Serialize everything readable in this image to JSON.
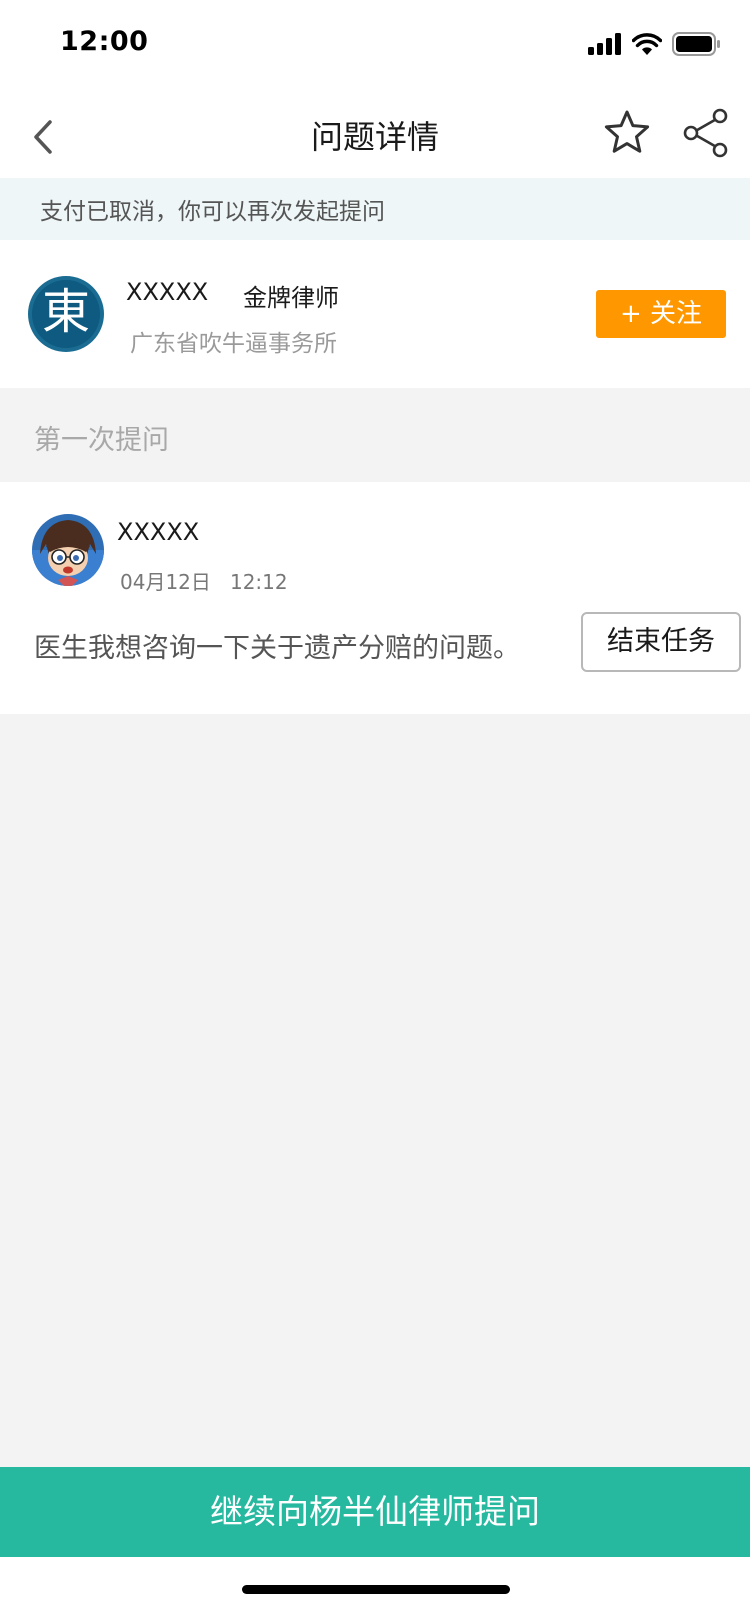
{
  "status_bar": {
    "time": "12:00",
    "icons": [
      "cellular-signal-icon",
      "wifi-icon",
      "battery-icon"
    ]
  },
  "nav": {
    "title": "问题详情",
    "back_icon": "chevron-left-icon",
    "star_icon": "star-outline-icon",
    "share_icon": "share-icon"
  },
  "notice": {
    "text": "支付已取消，你可以再次发起提问"
  },
  "lawyer": {
    "avatar_char": "東",
    "name": "XXXXX",
    "title": "金牌律师",
    "firm": "广东省吹牛逼事务所",
    "follow_label": "+ 关注"
  },
  "section": {
    "label": "第一次提问"
  },
  "question": {
    "asker_name": "XXXXX",
    "date": "04月12日",
    "time": "12:12",
    "text": "医生我想咨询一下关于遗产分赔的问题。",
    "end_task_label": "结束任务"
  },
  "cta": {
    "label": "继续向杨半仙律师提问"
  },
  "colors": {
    "follow": "#ff9800",
    "cta": "#27b8a0",
    "notice_bg": "#eef6f8",
    "page_bg": "#f3f3f3"
  }
}
